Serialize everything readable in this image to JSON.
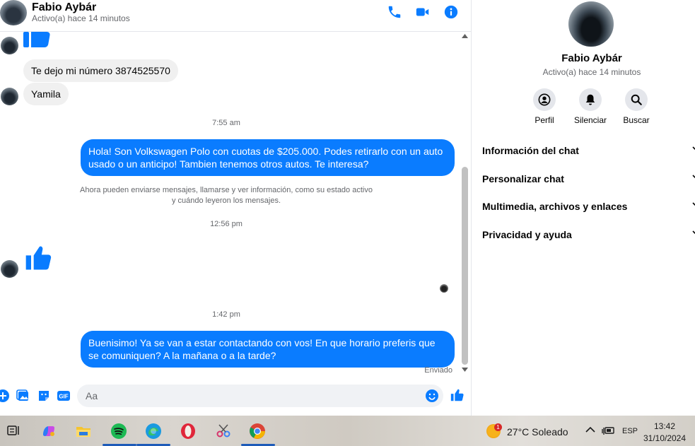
{
  "header": {
    "name": "Fabio Aybár",
    "status": "Activo(a) hace 14 minutos"
  },
  "messages": {
    "incoming_1": "Te dejo mi número 3874525570",
    "incoming_2": "Yamila",
    "timestamp_1": "7:55 am",
    "outgoing_1": "Hola! Son Volkswagen Polo con cuotas de $205.000. Podes retirarlo con un auto usado o un anticipo! Tambien tenemos otros autos. Te interesa?",
    "system_note_line1": "Ahora pueden enviarse mensajes, llamarse y ver información, como su estado activo",
    "system_note_line2": "y cuándo leyeron los mensajes.",
    "timestamp_2": "12:56 pm",
    "timestamp_3": "1:42 pm",
    "outgoing_2": "Buenisimo! Ya se van a estar contactando con vos! En que horario preferis que se comuniquen? A la mañana o a la tarde?",
    "sent_label": "Enviado"
  },
  "composer": {
    "placeholder": "Aa",
    "gif_label": "GIF"
  },
  "info_panel": {
    "name": "Fabio Aybár",
    "status": "Activo(a) hace 14 minutos",
    "actions": [
      "Perfil",
      "Silenciar",
      "Buscar"
    ],
    "sections": [
      "Información del chat",
      "Personalizar chat",
      "Multimedia, archivos y enlaces",
      "Privacidad y ayuda"
    ]
  },
  "taskbar": {
    "weather_badge": "1",
    "weather": "27°C  Soleado",
    "language": "ESP",
    "time": "13:42",
    "date": "31/10/2024"
  },
  "colors": {
    "accent": "#0a7cff",
    "incoming_bubble": "#f0f0f0",
    "muted_text": "#65676b"
  }
}
